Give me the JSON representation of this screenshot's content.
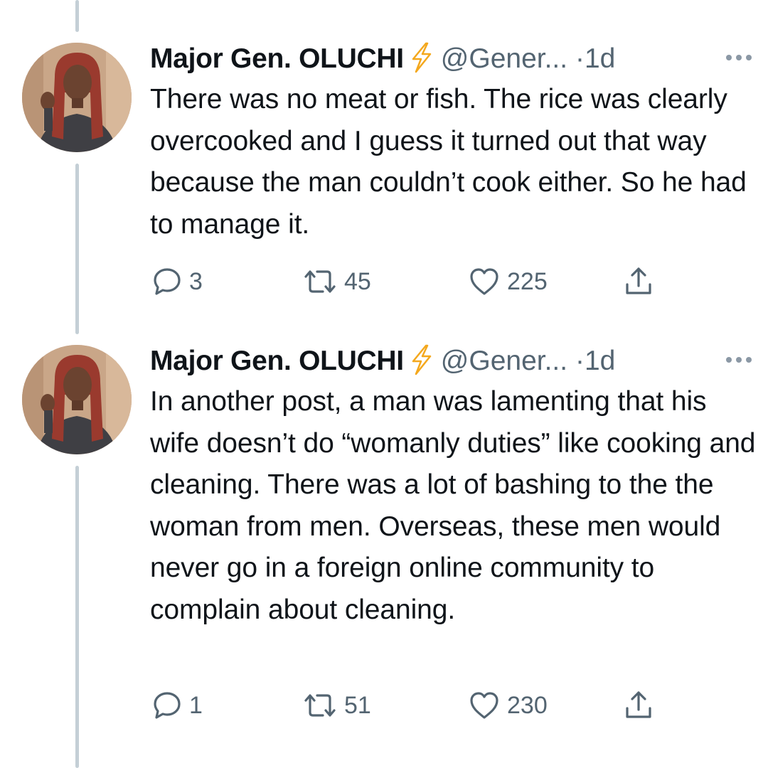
{
  "tweets": [
    {
      "author_name": "Major Gen. OLUCHI",
      "badge_icon": "lightning-bolt-icon",
      "handle": "@Gener...",
      "separator": "·",
      "time": "1d",
      "text": "There was no meat or fish. The rice was clearly overcooked and I guess it turned out that way because the man couldn’t cook either. So he had to manage it.",
      "replies": "3",
      "retweets": "45",
      "likes": "225"
    },
    {
      "author_name": "Major Gen. OLUCHI",
      "badge_icon": "lightning-bolt-icon",
      "handle": "@Gener...",
      "separator": "·",
      "time": "1d",
      "text": "In another post, a man was lamenting that his wife doesn’t do “womanly duties” like cooking and cleaning. There was a lot of bashing to the the woman from men. Overseas, these men would never go in a foreign online community to complain about cleaning.",
      "replies": "1",
      "retweets": "51",
      "likes": "230"
    }
  ],
  "colors": {
    "text": "#0f1419",
    "secondary": "#536471",
    "thread_line": "#c4cfd6",
    "bolt": "#f4a81d"
  }
}
